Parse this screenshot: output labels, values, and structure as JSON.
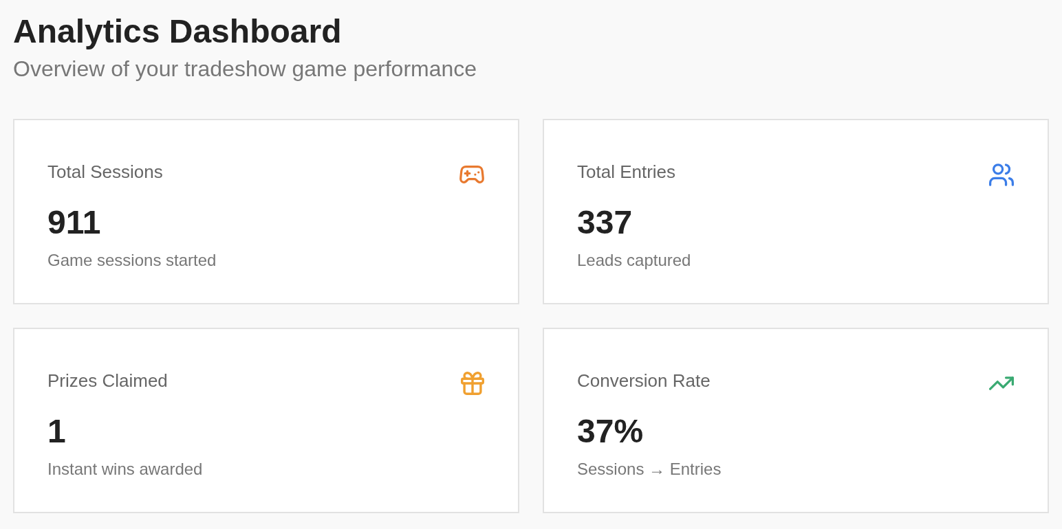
{
  "header": {
    "title": "Analytics Dashboard",
    "subtitle": "Overview of your tradeshow game performance"
  },
  "cards": [
    {
      "kind": "sessions",
      "label": "Total Sessions",
      "value": "911",
      "caption": "Game sessions started",
      "color": "#e8792f"
    },
    {
      "kind": "entries",
      "label": "Total Entries",
      "value": "337",
      "caption": "Leads captured",
      "color": "#3b7de8"
    },
    {
      "kind": "prizes",
      "label": "Prizes Claimed",
      "value": "1",
      "caption": "Instant wins awarded",
      "color": "#f0a030"
    },
    {
      "kind": "conversion",
      "label": "Conversion Rate",
      "value": "37%",
      "caption": "Sessions → Entries",
      "color": "#3aaa72"
    }
  ]
}
